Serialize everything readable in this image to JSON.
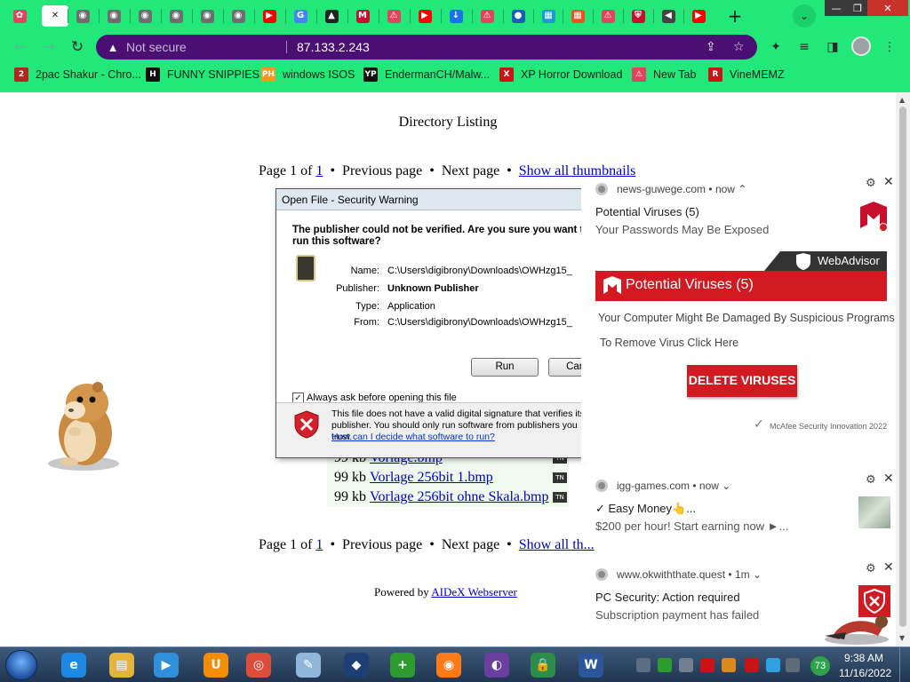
{
  "window_controls": {
    "minimize": "—",
    "restore": "❐",
    "close": "✕"
  },
  "tabs": [
    {
      "icon": "pinwheel-icon",
      "color": "#e0455d",
      "glyph": "✿"
    },
    {
      "icon": "close-icon",
      "color": "#1b1b1b",
      "glyph": "✕",
      "active": true
    },
    {
      "icon": "globe-icon",
      "color": "#6e6e6e",
      "glyph": "◉"
    },
    {
      "icon": "globe-icon",
      "color": "#6e6e6e",
      "glyph": "◉"
    },
    {
      "icon": "globe-icon",
      "color": "#6e6e6e",
      "glyph": "◉"
    },
    {
      "icon": "globe-icon",
      "color": "#6e6e6e",
      "glyph": "◉"
    },
    {
      "icon": "globe-icon",
      "color": "#6e6e6e",
      "glyph": "◉"
    },
    {
      "icon": "globe-icon",
      "color": "#6e6e6e",
      "glyph": "◉"
    },
    {
      "icon": "youtube-icon",
      "color": "#ff0000",
      "glyph": "▶"
    },
    {
      "icon": "google-icon",
      "color": "#4285f4",
      "glyph": "G"
    },
    {
      "icon": "cloud-upload-icon",
      "color": "#222222",
      "glyph": "▲"
    },
    {
      "icon": "mcafee-icon",
      "color": "#c8102e",
      "glyph": "M"
    },
    {
      "icon": "alert-page-icon",
      "color": "#e0455d",
      "glyph": "⚠"
    },
    {
      "icon": "youtube-icon",
      "color": "#ff0000",
      "glyph": "▶"
    },
    {
      "icon": "download-icon",
      "color": "#1a73e8",
      "glyph": "↓"
    },
    {
      "icon": "alert-page-icon",
      "color": "#e0455d",
      "glyph": "⚠"
    },
    {
      "icon": "blue-globe-icon",
      "color": "#1a5fb4",
      "glyph": "●"
    },
    {
      "icon": "grid-icon",
      "color": "#1c9ad6",
      "glyph": "▦"
    },
    {
      "icon": "windows-icon",
      "color": "#f25022",
      "glyph": "▦"
    },
    {
      "icon": "alert-page-icon",
      "color": "#e0455d",
      "glyph": "⚠"
    },
    {
      "icon": "shield-icon",
      "color": "#c8102e",
      "glyph": "⛨"
    },
    {
      "icon": "audio-icon",
      "color": "#444444",
      "glyph": "◀"
    },
    {
      "icon": "youtube-icon",
      "color": "#ff0000",
      "glyph": "▶"
    }
  ],
  "new_tab_glyph": "+",
  "tab_search_glyph": "⌄",
  "nav": {
    "back": "←",
    "forward": "→",
    "reload": "↻"
  },
  "omnibox": {
    "security_label": "Not secure",
    "url": "87.133.2.243",
    "share_icon": "⇪",
    "star_icon": "☆"
  },
  "toolbar_icons": {
    "extensions": "✦",
    "media": "≡",
    "sidepanel": "◨",
    "menu": "⋮"
  },
  "bookmarks": [
    {
      "label": "2pac Shakur - Chro...",
      "fav": "2",
      "color": "#b3261e"
    },
    {
      "label": "FUNNY SNIPPIES",
      "fav": "H",
      "color": "#111111"
    },
    {
      "label": "windows ISOS",
      "fav": "PH",
      "color": "#f7971d"
    },
    {
      "label": "EndermanCH/Malw...",
      "fav": "YP",
      "color": "#111111"
    },
    {
      "label": "XP Horror Download",
      "fav": "X",
      "color": "#c81414"
    },
    {
      "label": "New Tab",
      "fav": "⚠",
      "color": "#e0455d"
    },
    {
      "label": "VineMEMZ",
      "fav": "R",
      "color": "#c81414"
    }
  ],
  "page": {
    "title": "Directory Listing",
    "pager": {
      "page_prefix": "Page 1 of ",
      "page_link": "1",
      "prev": "Previous page",
      "next": "Next page",
      "thumbs": "Show all thumbnails",
      "thumbs_bottom": "Show all th...",
      "sep": "•"
    },
    "files": [
      {
        "size": "99 kb",
        "name": "Vorlage.bmp",
        "tn": "TN"
      },
      {
        "size": "99 kb",
        "name": "Vorlage 256bit 1.bmp",
        "tn": "TN"
      },
      {
        "size": "99 kb",
        "name": "Vorlage 256bit ohne Skala.bmp",
        "tn": "TN"
      }
    ],
    "powered_prefix": "Powered by ",
    "powered_link": "AIDeX Webserver"
  },
  "dialog": {
    "title": "Open File - Security Warning",
    "warning": "The publisher could not be verified.  Are you sure you want to run this software?",
    "fields": [
      {
        "label": "Name:",
        "value": "C:\\Users\\digibrony\\Downloads\\OWHzg15_"
      },
      {
        "label": "Publisher:",
        "value": "Unknown Publisher"
      },
      {
        "label": "Type:",
        "value": "Application"
      },
      {
        "label": "From:",
        "value": "C:\\Users\\digibrony\\Downloads\\OWHzg15_"
      }
    ],
    "run_label": "Run",
    "cancel_label": "Cancel",
    "checkbox_label": "Always ask before opening this file",
    "checkbox_glyph": "✓",
    "footer_text": "This file does not have a valid digital signature that verifies its publisher.  You should only run software from publishers you trust.",
    "footer_link": "How can I decide what software to run?"
  },
  "notifications": [
    {
      "source": "news-guwege.com",
      "time": "now",
      "caret": "⌃",
      "title": "Potential Viruses (5)",
      "body": "Your Passwords May Be Exposed",
      "ad": {
        "brand": "WebAdvisor",
        "headline": "Potential Viruses (5)",
        "line1": "Your Computer Might Be Damaged By Suspicious Programs",
        "line2": "To Remove Virus Click Here",
        "button": "DELETE VIRUSES",
        "footer": "McAfee Security Innovation 2022",
        "red": "#d11a22"
      }
    },
    {
      "source": "igg-games.com",
      "time": "now",
      "caret": "⌄",
      "title": "✓ Easy Money👆...",
      "body": "$200 per hour! Start earning now ►..."
    },
    {
      "source": "www.okwiththate.quest",
      "time": "1m",
      "caret": "⌄",
      "title": "PC Security: Action required",
      "body": "Subscription payment has failed"
    }
  ],
  "notif_icons": {
    "gear": "⚙",
    "close": "✕",
    "dot": "•"
  },
  "taskbar": {
    "apps": [
      {
        "name": "internet-explorer-icon",
        "color": "#1e88e5",
        "glyph": "e"
      },
      {
        "name": "file-explorer-icon",
        "color": "#e5b53a",
        "glyph": "▤"
      },
      {
        "name": "media-player-icon",
        "color": "#2f8fd8",
        "glyph": "▶"
      },
      {
        "name": "uc-browser-icon",
        "color": "#f48c06",
        "glyph": "U"
      },
      {
        "name": "chrome-icon",
        "color": "#dd4b39",
        "glyph": "◎"
      },
      {
        "name": "notepad-icon",
        "color": "#8fb7d9",
        "glyph": "✎"
      },
      {
        "name": "cube-app-icon",
        "color": "#1d3f73",
        "glyph": "◆"
      },
      {
        "name": "plus-app-icon",
        "color": "#2e9b2e",
        "glyph": "+"
      },
      {
        "name": "firefox-icon",
        "color": "#ff7a18",
        "glyph": "◉"
      },
      {
        "name": "mask-app-icon",
        "color": "#6b3fa0",
        "glyph": "◐"
      },
      {
        "name": "lock-shield-icon",
        "color": "#2c8c4a",
        "glyph": "🔒"
      },
      {
        "name": "word-icon",
        "color": "#2b579a",
        "glyph": "W"
      }
    ],
    "tray": [
      {
        "name": "shield-tray-icon",
        "color": "#5a6e86"
      },
      {
        "name": "plus-tray-icon",
        "color": "#2e9b2e"
      },
      {
        "name": "grid-tray-icon",
        "color": "#6f7f8f"
      },
      {
        "name": "v-tray-icon",
        "color": "#c81414"
      },
      {
        "name": "search-tray-icon",
        "color": "#d9891e"
      },
      {
        "name": "flag-tray-icon",
        "color": "#c81414"
      },
      {
        "name": "monitor-tray-icon",
        "color": "#2fa0e0"
      },
      {
        "name": "network-tray-icon",
        "color": "#5f6b78"
      },
      {
        "name": "volume-tray-icon",
        "color": "#6e7c8c"
      }
    ],
    "badge": "73",
    "time": "9:38 AM",
    "date": "11/16/2022"
  }
}
